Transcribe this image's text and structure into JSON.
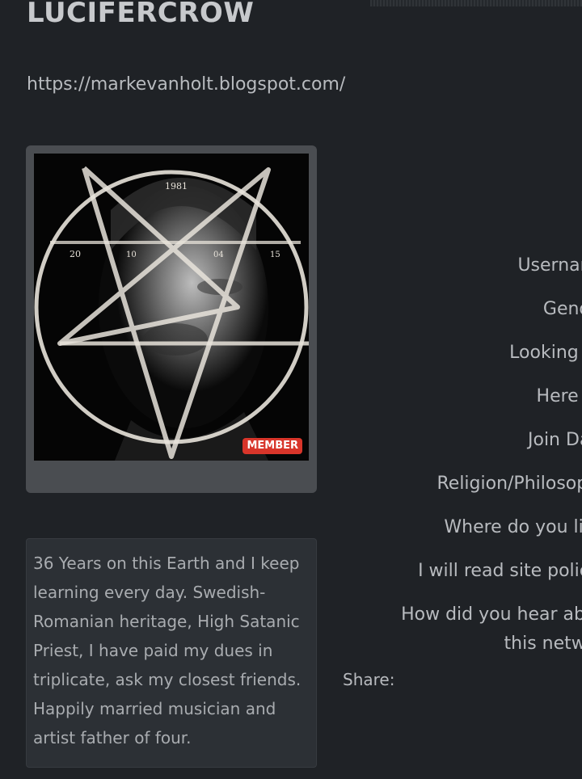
{
  "profile": {
    "name": "LUCIFERCROW",
    "url": "https://markevanholt.blogspot.com/"
  },
  "photo": {
    "badge": "MEMBER",
    "overlay_numbers": [
      "1981",
      "20",
      "10",
      "04",
      "15"
    ]
  },
  "bio": "36 Years on this Earth and I keep learning every day. Swedish-Romanian heritage, High Satanic Priest, I have paid my dues in triplicate, ask my closest friends. Happily married musician and artist father of four.",
  "fields": [
    {
      "label": "Username:"
    },
    {
      "label": "Gender:"
    },
    {
      "label": "Looking for:"
    },
    {
      "label": "Here for:"
    },
    {
      "label": "Join Date:"
    },
    {
      "label": "Religion/Philosophy:"
    },
    {
      "label": "Where do you live?"
    },
    {
      "label": "I will read site policies"
    },
    {
      "label": "How did you hear about this network"
    }
  ],
  "share_label": "Share:",
  "colors": {
    "background": "#1f2226",
    "text": "#b8bbbf",
    "badge": "#d8352a"
  }
}
